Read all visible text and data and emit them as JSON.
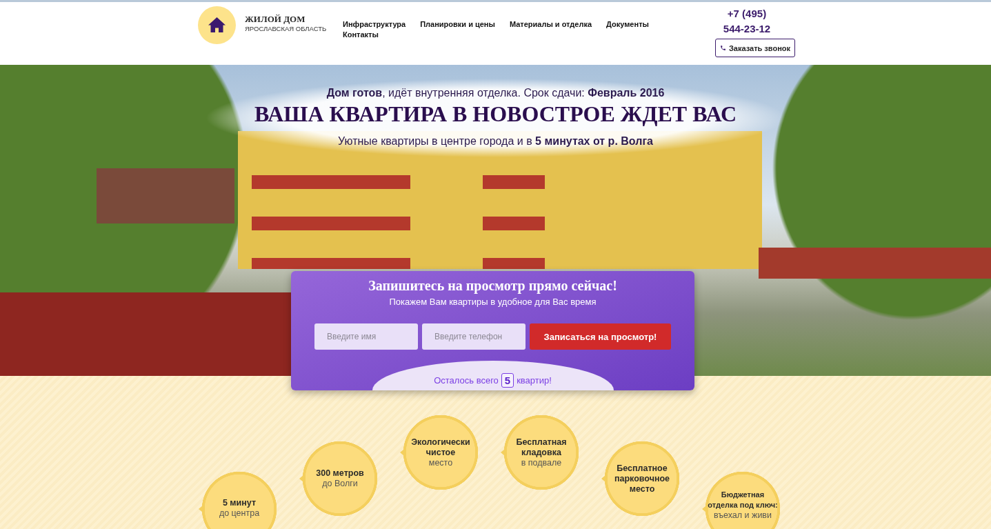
{
  "header": {
    "logo": {
      "title": "ЖИЛОЙ ДОМ",
      "subtitle": "ЯРОСЛАВСКАЯ ОБЛАСТЬ"
    },
    "nav": [
      "Инфраструктура",
      "Планировки и цены",
      "Материалы и отделка",
      "Документы",
      "Контакты"
    ],
    "phone": "+7 (495) 544-23-12",
    "callback_button": "Заказать звонок"
  },
  "hero": {
    "status": "**Дом готов**, идёт внутренняя отделка. Срок сдачи: **Февраль 2016**",
    "headline": "ВАША КВАРТИРА В НОВОСТРОЕ ЖДЕТ ВАС",
    "tagline": "Уютные квартиры в центре города и в **5 минутах от р. Волга**"
  },
  "signup_form": {
    "title": "Запишитесь на просмотр прямо сейчас!",
    "subtitle": "Покажем Вам квартиры в удобное для Вас время",
    "fields": [
      {
        "placeholder": "Введите имя"
      },
      {
        "placeholder": "Введите телефон"
      }
    ],
    "submit_button": "Записаться на просмотр!",
    "remaining": {
      "prefix": "Осталось всего",
      "count": "5",
      "suffix": "квартир!"
    }
  },
  "features": [
    {
      "title": "5 минут",
      "subtitle": "до центра"
    },
    {
      "title": "300 метров",
      "subtitle": "до Волги"
    },
    {
      "title": "Экологически чистое",
      "subtitle": "место"
    },
    {
      "title": "Бесплатная кладовка",
      "subtitle": "в подвале"
    },
    {
      "title": "Бесплатное парковочное место"
    },
    {
      "title": "Бюджетная отделка под ключ:",
      "subtitle": "въехал и живи"
    }
  ]
}
